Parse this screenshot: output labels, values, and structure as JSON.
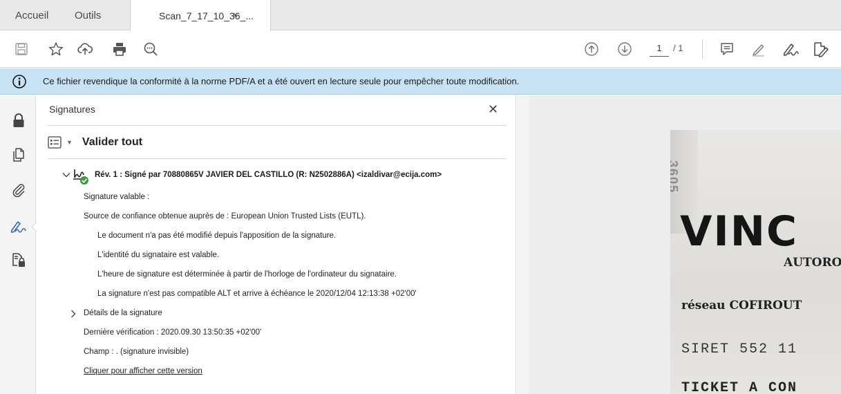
{
  "tabs": {
    "home": "Accueil",
    "tools": "Outils",
    "document": "Scan_7_17_10_36_...",
    "close_glyph": "×"
  },
  "toolbar": {
    "icons": [
      "save-icon",
      "star-icon",
      "upload-icon",
      "print-icon",
      "search-zoom-icon",
      "prev-page-icon",
      "next-page-icon",
      "comment-icon",
      "highlight-icon",
      "sign-icon",
      "fill-sign-icon"
    ],
    "page_current": "1",
    "page_total": "/ 1"
  },
  "banner": {
    "text": "Ce fichier revendique la conformité à la norme PDF/A et a été ouvert en lecture seule pour empêcher toute modification."
  },
  "rail": {
    "icons": [
      "lock-icon",
      "pages-icon",
      "attachment-icon",
      "signature-pen-icon",
      "security-doc-icon"
    ],
    "active": "signature-pen-icon"
  },
  "panel": {
    "title": "Signatures",
    "close_glyph": "✕",
    "validate_all": "Valider tout",
    "signature": {
      "title": "Rév. 1 : Signé par 70880865V JAVIER DEL CASTILLO (R: N2502886A) <izaldivar@ecija.com>",
      "status_color": "#3a9b3a",
      "lines": [
        "Signature valable :",
        "Source de confiance obtenue auprès de : European Union Trusted Lists (EUTL)."
      ],
      "sublines": [
        "Le document n'a pas été modifié depuis l'apposition de la signature.",
        "L'identité du signataire est valable.",
        "L'heure de signature est déterminée à partir de l'horloge de l'ordinateur du signataire.",
        "La signature n'est pas compatible ALT et arrive à échéance le 2020/12/04 12:13:38 +02'00'"
      ],
      "details": "Détails de la signature",
      "last_check": "Dernière vérification : 2020.09.30 13:50:35 +02'00'",
      "field": "Champ : . (signature invisible)",
      "view_version": "Cliquer pour afficher cette version"
    }
  },
  "document": {
    "logo_fragment": "VINC",
    "subtitle_fragment": "AUTORO",
    "network_line": "réseau COFIROUT",
    "siret_line": "SIRET 552 11",
    "ticket_line": "TICKET A CON",
    "side_code": "3605"
  },
  "colors": {
    "banner_bg": "#c7e2f4",
    "accent_blue": "#2f6ec2",
    "valid_green": "#3a9b3a"
  }
}
